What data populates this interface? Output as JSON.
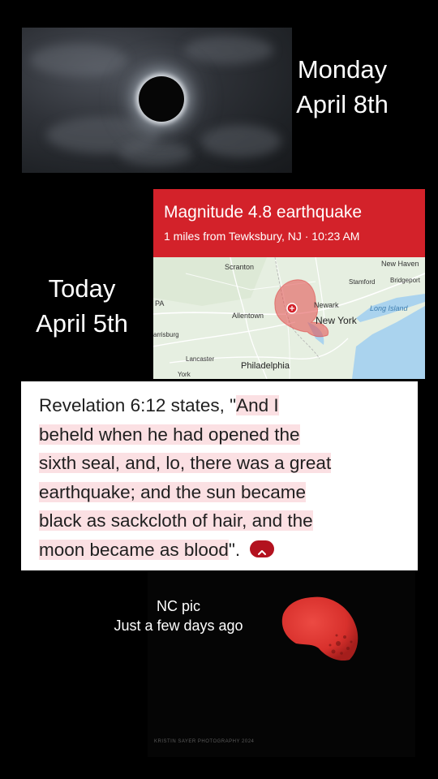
{
  "eclipse": {
    "date_line1": "Monday",
    "date_line2": "April 8th"
  },
  "today": {
    "line1": "Today",
    "line2": "April 5th"
  },
  "earthquake": {
    "title": "Magnitude 4.8 earthquake",
    "subtitle": "1 miles from Tewksbury, NJ · 10:23 AM",
    "header_color": "#d3222a",
    "map_labels": {
      "scranton": "Scranton",
      "new_haven": "New Haven",
      "stamford": "Stamford",
      "bridgeport": "Bridgeport",
      "pa": "PA",
      "newark": "Newark",
      "long_island": "Long Island",
      "allentown": "Allentown",
      "new_york": "New York",
      "harrisburg": "arrisburg",
      "lancaster": "Lancaster",
      "york": "York",
      "philadelphia": "Philadelphia"
    }
  },
  "verse": {
    "prefix": "Revelation 6:12 states, \"",
    "line1": "And I",
    "line2": "beheld when he had opened the",
    "line3": "sixth seal, and, lo, there was a great",
    "line4": "earthquake; and the sun became",
    "line5": "black as sackcloth of hair, and the",
    "line6": "moon became as blood",
    "suffix": "\".",
    "highlight_color": "#fbe0e3",
    "button_icon": "chevron-up-icon",
    "button_color": "#b3121f"
  },
  "moon": {
    "caption_line1": "NC pic",
    "caption_line2": "Just a few days ago",
    "watermark": "KRISTIN SAYER PHOTOGRAPHY 2024",
    "moon_color": "#e0302e"
  }
}
